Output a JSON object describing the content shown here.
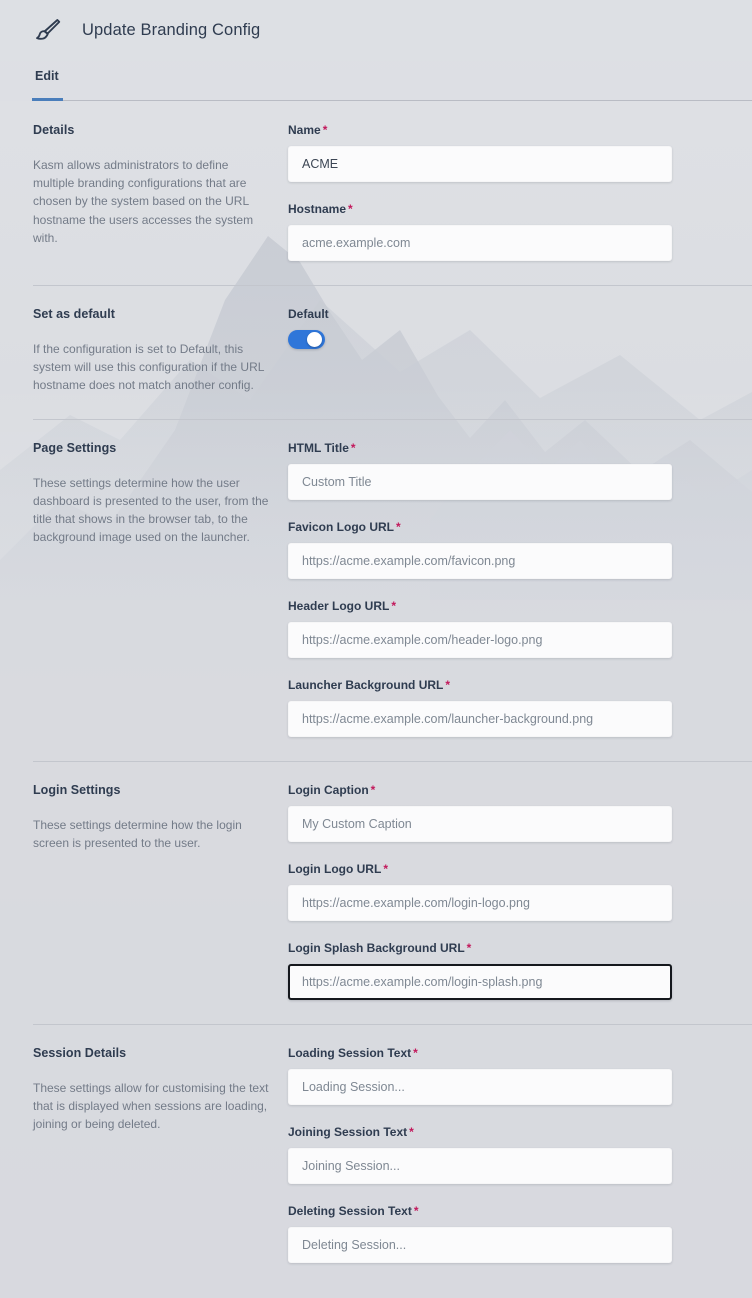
{
  "header": {
    "icon": "paintbrush-icon",
    "title": "Update Branding Config"
  },
  "tabs": [
    {
      "label": "Edit",
      "active": true
    }
  ],
  "accent_color": "#4a7ebb",
  "toggle_color": "#2f76d9",
  "required_marker": "*",
  "sections": [
    {
      "title": "Details",
      "description": "Kasm allows administrators to define multiple branding configurations that are chosen by the system based on the URL hostname the users accesses the system with.",
      "fields": [
        {
          "label": "Name",
          "required": "*",
          "value": "ACME",
          "placeholder": "",
          "focused": false
        },
        {
          "label": "Hostname",
          "required": "*",
          "value": "",
          "placeholder": "acme.example.com",
          "focused": false
        }
      ]
    },
    {
      "title": "Set as default",
      "description": "If the configuration is set to Default, this system will use this configuration if the URL hostname does not match another config.",
      "toggle": {
        "label": "Default",
        "on": true
      }
    },
    {
      "title": "Page Settings",
      "description": "These settings determine how the user dashboard is presented to the user, from the title that shows in the browser tab, to the background image used on the launcher.",
      "fields": [
        {
          "label": "HTML Title",
          "required": "*",
          "value": "",
          "placeholder": "Custom Title",
          "focused": false
        },
        {
          "label": "Favicon Logo URL",
          "required": "*",
          "value": "",
          "placeholder": "https://acme.example.com/favicon.png",
          "focused": false
        },
        {
          "label": "Header Logo URL",
          "required": "*",
          "value": "",
          "placeholder": "https://acme.example.com/header-logo.png",
          "focused": false
        },
        {
          "label": "Launcher Background URL",
          "required": "*",
          "value": "",
          "placeholder": "https://acme.example.com/launcher-background.png",
          "focused": false
        }
      ]
    },
    {
      "title": "Login Settings",
      "description": "These settings determine how the login screen is presented to the user.",
      "fields": [
        {
          "label": "Login Caption",
          "required": "*",
          "value": "",
          "placeholder": "My Custom Caption",
          "focused": false
        },
        {
          "label": "Login Logo URL",
          "required": "*",
          "value": "",
          "placeholder": "https://acme.example.com/login-logo.png",
          "focused": false
        },
        {
          "label": "Login Splash Background URL",
          "required": "*",
          "value": "",
          "placeholder": "https://acme.example.com/login-splash.png",
          "focused": true
        }
      ]
    },
    {
      "title": "Session Details",
      "description": "These settings allow for customising the text that is displayed when sessions are loading, joining or being deleted.",
      "fields": [
        {
          "label": "Loading Session Text",
          "required": "*",
          "value": "",
          "placeholder": "Loading Session...",
          "focused": false
        },
        {
          "label": "Joining Session Text",
          "required": "*",
          "value": "",
          "placeholder": "Joining Session...",
          "focused": false
        },
        {
          "label": "Deleting Session Text",
          "required": "*",
          "value": "",
          "placeholder": "Deleting Session...",
          "focused": false
        }
      ]
    }
  ]
}
